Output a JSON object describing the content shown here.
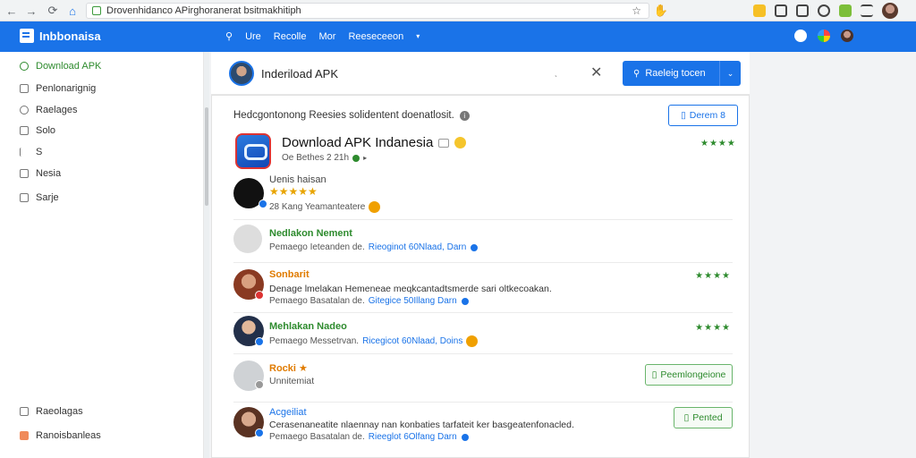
{
  "browser": {
    "url": "Drovenhidanco APirghoranerat bsitmakhitiph",
    "back": "←",
    "forward": "→",
    "reload": "⟳",
    "home": "⌂",
    "star": "☆",
    "cursor": "✋"
  },
  "header": {
    "brand": "Inbbonaisa",
    "nav": [
      {
        "label": "Ure"
      },
      {
        "label": "Recolle"
      },
      {
        "label": "Mor"
      },
      {
        "label": "Reeseceeon"
      }
    ]
  },
  "sidebar": {
    "items": [
      {
        "label": "Download APK",
        "active": true
      },
      {
        "label": "Penlonarignig"
      },
      {
        "label": "Raelages"
      },
      {
        "label": "Solo"
      },
      {
        "label": "S"
      },
      {
        "label": "Nesia"
      },
      {
        "label": "Sarje"
      }
    ],
    "bottom": [
      {
        "label": "Raeolagas"
      },
      {
        "label": "Ranoisbanleas"
      }
    ]
  },
  "topcard": {
    "title": "Inderiload APK",
    "button_label": "Raeleig tocen"
  },
  "panel": {
    "notice": "Hedcgontonong Reesies solidentent doenatlosit.",
    "top_button": "Derem 8",
    "app": {
      "title": "Download APK Indanesia",
      "meta": "Oe Bethes 2 21h",
      "rating": "★★★★"
    },
    "reviews": [
      {
        "name": "Uenis haisan",
        "stars": "★★★★★",
        "meta": "28 Kang Yeamanteatere"
      },
      {
        "name": "Nedlakon Nement",
        "meta_prefix": "Pemaego Ieteanden de.",
        "meta_link": "Rieoginot 60Nlaad, Darn"
      },
      {
        "name": "Sonbarit",
        "text": "Denage lmelakan Hemeneae meqkcantadtsmerde sari oltkecoakan.",
        "meta_prefix": "Pemaego Basatalan de.",
        "meta_link": "Gitegice 50Illang Darn",
        "stars": "★★★★"
      },
      {
        "name": "Mehlakan Nadeo",
        "meta_prefix": "Pemaego Messetrvan.",
        "meta_link": "Ricegicot 60Nlaad, Doins",
        "stars": "★★★★"
      },
      {
        "name": "Rocki ★",
        "line": "Unnitemiat",
        "button": "Peemlongeione"
      },
      {
        "name": "Acgeiliat",
        "text": "Cerasenaneatite nlaennay nan konbaties tarfateit ker basgeatenfonacled.",
        "meta_prefix": "Pemaego Basatalan de.",
        "meta_link": "Rieeglot 6Olfang Darn",
        "button": "Pented"
      }
    ]
  }
}
